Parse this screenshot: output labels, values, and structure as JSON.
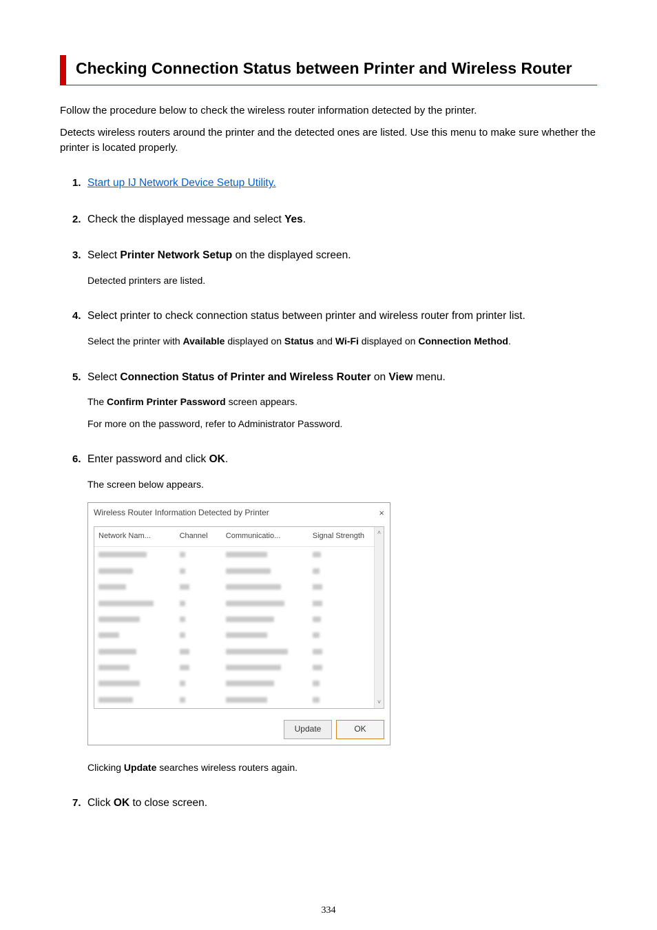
{
  "title": "Checking Connection Status between Printer and Wireless Router",
  "intro1": "Follow the procedure below to check the wireless router information detected by the printer.",
  "intro2": "Detects wireless routers around the printer and the detected ones are listed. Use this menu to make sure whether the printer is located properly.",
  "steps": [
    {
      "n": "1.",
      "link": "Start up IJ Network Device Setup Utility."
    },
    {
      "n": "2.",
      "pre": "Check the displayed message and select ",
      "b1": "Yes",
      "post": "."
    },
    {
      "n": "3.",
      "pre": "Select ",
      "b1": "Printer Network Setup",
      "post": " on the displayed screen.",
      "sub": [
        "Detected printers are listed."
      ]
    },
    {
      "n": "4.",
      "text": "Select printer to check connection status between printer and wireless router from printer list.",
      "sub_rich": {
        "t0": "Select the printer with ",
        "b0": "Available",
        "t1": " displayed on ",
        "b1": "Status",
        "t2": " and ",
        "b2": "Wi-Fi",
        "t3": " displayed on ",
        "b3": "Connection Method",
        "t4": "."
      }
    },
    {
      "n": "5.",
      "pre": "Select ",
      "b1": "Connection Status of Printer and Wireless Router",
      "mid": " on ",
      "b2": "View",
      "post": " menu.",
      "sub_rich5a": {
        "t0": "The ",
        "b0": "Confirm Printer Password",
        "t1": " screen appears."
      },
      "sub5b": "For more on the password, refer to Administrator Password."
    },
    {
      "n": "6.",
      "pre": "Enter password and click ",
      "b1": "OK",
      "post": ".",
      "sub": [
        "The screen below appears."
      ],
      "after_rich": {
        "t0": "Clicking ",
        "b0": "Update",
        "t1": " searches wireless routers again."
      }
    },
    {
      "n": "7.",
      "pre": "Click ",
      "b1": "OK",
      "post": " to close screen."
    }
  ],
  "dialog": {
    "title": "Wireless Router Information Detected by Printer",
    "headers": [
      "Network Nam...",
      "Channel",
      "Communicatio...",
      "Signal Strength"
    ],
    "rows": 10,
    "buttons": {
      "update": "Update",
      "ok": "OK"
    }
  },
  "page_number": "334"
}
